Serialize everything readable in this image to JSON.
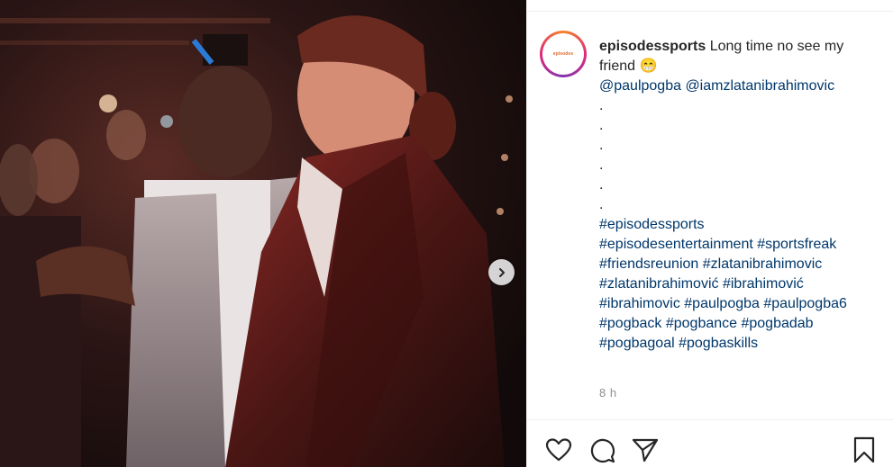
{
  "post": {
    "username": "episodessports",
    "caption_text": " Long time no see my",
    "caption_text_2": "friend 😁",
    "mentions": [
      "@paulpogba",
      "@iamzlatanibrahimovic"
    ],
    "dots": [
      ".",
      ".",
      ".",
      ".",
      ".",
      "."
    ],
    "hashtag_lines": [
      [
        "#episodessports"
      ],
      [
        "#episodesentertainment",
        "#sportsfreak"
      ],
      [
        "#friendsreunion",
        "#zlatanibrahimovic"
      ],
      [
        "#zlatanibrahimović",
        "#ibrahimović"
      ],
      [
        "#ibrahimovic",
        "#paulpogba",
        "#paulpogba6"
      ],
      [
        "#pogback",
        "#pogbance",
        "#pogbadab"
      ],
      [
        "#pogbagoal",
        "#pogbaskills"
      ]
    ],
    "timestamp": "8 h",
    "avatar_text": "episodes"
  },
  "icons": {
    "like": "heart-icon",
    "comment": "comment-bubble-icon",
    "share": "paper-plane-icon",
    "save": "bookmark-icon",
    "next": "chevron-right-icon"
  },
  "colors": {
    "link": "#00376b",
    "text": "#262626",
    "muted": "#8e8e8e",
    "divider": "#efefef"
  }
}
